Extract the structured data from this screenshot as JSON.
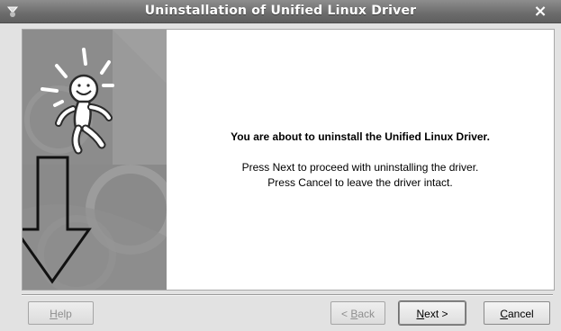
{
  "window": {
    "title": "Uninstallation of Unified Linux Driver",
    "close_glyph": "×",
    "menu_icon": "window-menu-icon",
    "close_icon": "close-icon"
  },
  "side_panel": {
    "illustration": "uninstall-figure-with-down-arrow"
  },
  "message": {
    "heading": "You are about to uninstall the Unified Linux Driver.",
    "line1": "Press Next to proceed with uninstalling the driver.",
    "line2": "Press Cancel to leave the driver intact."
  },
  "buttons": {
    "help": {
      "first": "H",
      "rest": "elp",
      "enabled": false
    },
    "back": {
      "prefix": "< ",
      "first": "B",
      "rest": "ack",
      "enabled": false
    },
    "next": {
      "first": "N",
      "rest": "ext >",
      "enabled": true
    },
    "cancel": {
      "first": "C",
      "rest": "ancel",
      "enabled": true
    }
  },
  "colors": {
    "titlebar": "#6c6c6c",
    "background": "#e2e2e2",
    "panel": "#ffffff",
    "disabled_text": "#8f8f8f"
  }
}
